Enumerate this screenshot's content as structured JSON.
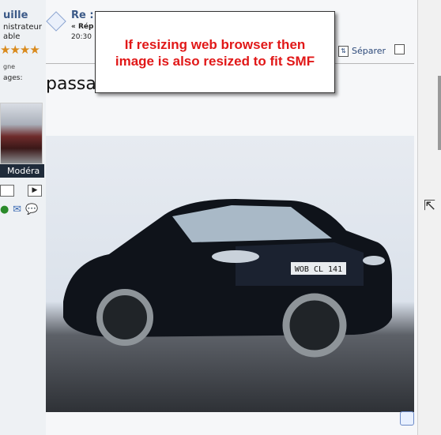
{
  "poster": {
    "name": "uille",
    "role": "nistrateur",
    "rank": "able",
    "stars": "★★★★",
    "line1": "gne",
    "line2": "ages:",
    "mod_label": "Modéra",
    "nav_prev": "",
    "nav_next": "▶"
  },
  "post": {
    "title": "Re :",
    "meta_line": "« Rép",
    "time": "20:30",
    "split_label": "Séparer",
    "body": "passa"
  },
  "callout": {
    "line1": "If resizing web browser then",
    "line2": "image is also resized to fit SMF"
  },
  "photo": {
    "plate": "WOB CL 141"
  }
}
